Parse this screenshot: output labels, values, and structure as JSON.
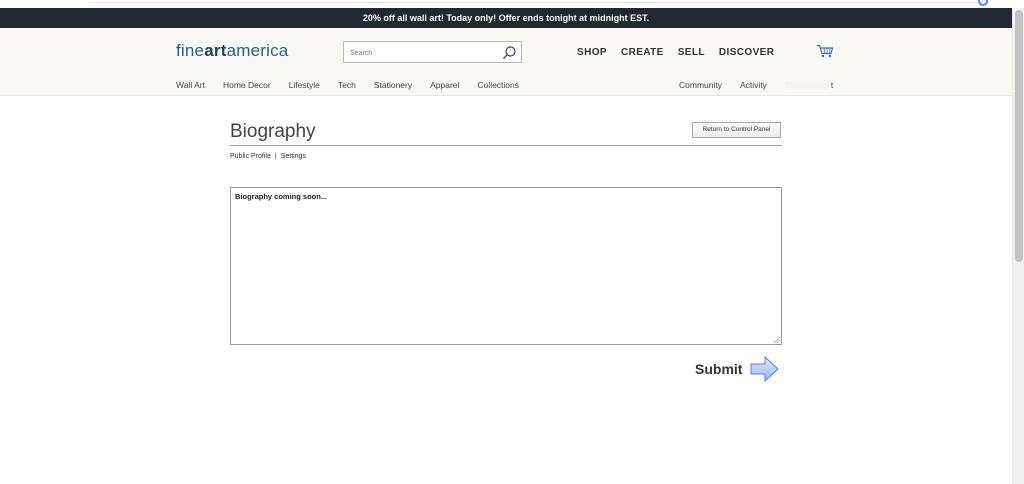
{
  "promo": {
    "text": "20% off all wall art!  Today only!  Offer ends tonight at midnight EST."
  },
  "header": {
    "logo": {
      "part1": "fine",
      "part2": "art",
      "part3": "america"
    },
    "search": {
      "placeholder": "Search",
      "value": "",
      "icon": "search-icon"
    },
    "main_nav": [
      "SHOP",
      "CREATE",
      "SELL",
      "DISCOVER"
    ],
    "cart_icon": "cart-icon",
    "sub_nav_left": [
      "Wall Art",
      "Home Decor",
      "Lifestyle",
      "Tech",
      "Stationery",
      "Apparel",
      "Collections"
    ],
    "sub_nav_right": [
      "Community",
      "Activity"
    ],
    "sub_nav_trailing": "t"
  },
  "main": {
    "title": "Biography",
    "return_button": "Return to Control Panel",
    "tabs": {
      "public_profile": "Public Profile",
      "separator": "|",
      "settings": "Settings"
    },
    "bio_text": "Biography coming soon...",
    "submit_label": "Submit",
    "submit_icon": "arrow-right-icon"
  },
  "colors": {
    "promo_bg": "#22282e",
    "logo_blue": "#2c5b8a",
    "arrow_blue": "#b9c9f5"
  }
}
